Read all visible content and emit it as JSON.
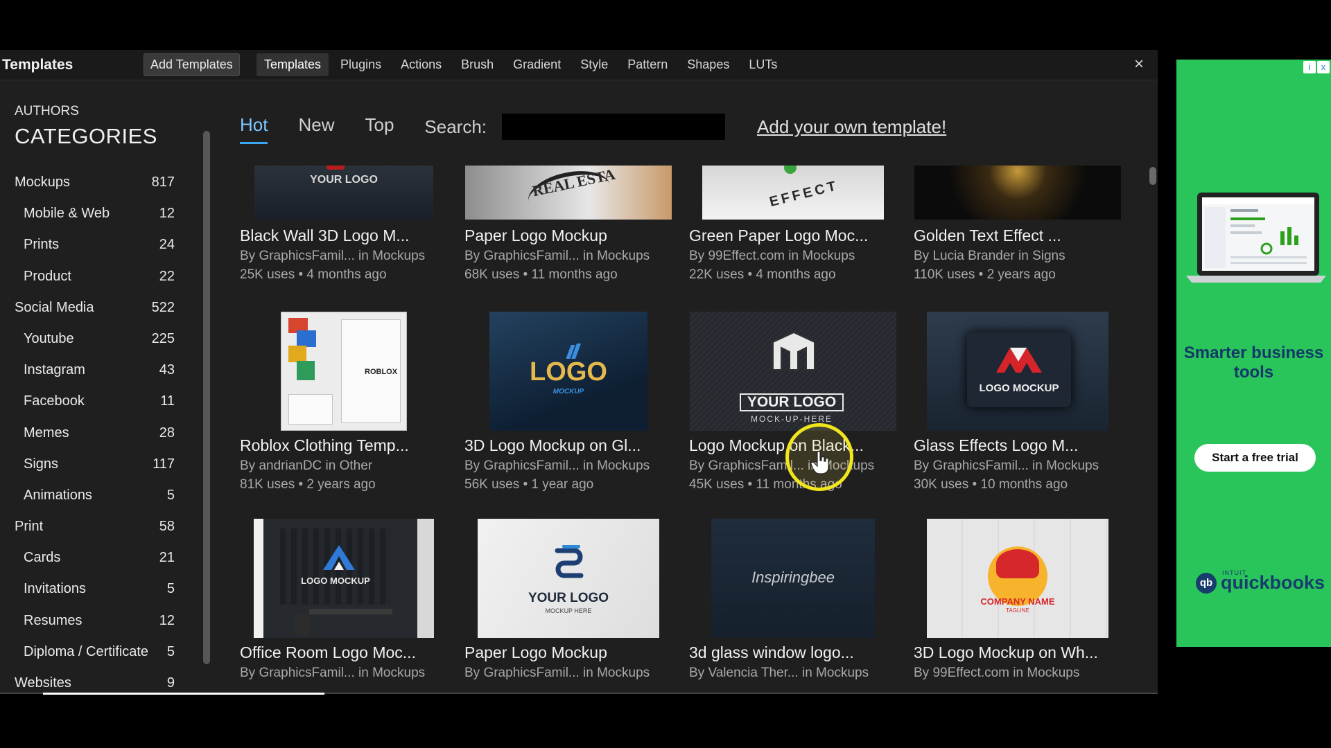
{
  "window": {
    "title": "Templates",
    "add_templates_label": "Add Templates",
    "tabs": [
      "Templates",
      "Plugins",
      "Actions",
      "Brush",
      "Gradient",
      "Style",
      "Pattern",
      "Shapes",
      "LUTs"
    ],
    "active_tab": "Templates",
    "close_label": "×"
  },
  "sidebar": {
    "authors_label": "AUTHORS",
    "categories_title": "CATEGORIES",
    "items": [
      {
        "label": "Mockups",
        "count": "817",
        "level": "top"
      },
      {
        "label": "Mobile & Web",
        "count": "12",
        "level": "sub"
      },
      {
        "label": "Prints",
        "count": "24",
        "level": "sub"
      },
      {
        "label": "Product",
        "count": "22",
        "level": "sub"
      },
      {
        "label": "Social Media",
        "count": "522",
        "level": "top"
      },
      {
        "label": "Youtube",
        "count": "225",
        "level": "sub"
      },
      {
        "label": "Instagram",
        "count": "43",
        "level": "sub"
      },
      {
        "label": "Facebook",
        "count": "11",
        "level": "sub"
      },
      {
        "label": "Memes",
        "count": "28",
        "level": "sub"
      },
      {
        "label": "Signs",
        "count": "117",
        "level": "sub"
      },
      {
        "label": "Animations",
        "count": "5",
        "level": "sub"
      },
      {
        "label": "Print",
        "count": "58",
        "level": "top"
      },
      {
        "label": "Cards",
        "count": "21",
        "level": "sub"
      },
      {
        "label": "Invitations",
        "count": "5",
        "level": "sub"
      },
      {
        "label": "Resumes",
        "count": "12",
        "level": "sub"
      },
      {
        "label": "Diploma / Certificate",
        "count": "5",
        "level": "sub"
      },
      {
        "label": "Websites",
        "count": "9",
        "level": "top"
      }
    ]
  },
  "content": {
    "subtabs": [
      "Hot",
      "New",
      "Top"
    ],
    "active_subtab": "Hot",
    "search_label": "Search:",
    "search_value": "",
    "add_own_label": "Add your own template!",
    "cards": [
      {
        "title": "Black Wall 3D Logo M...",
        "byline": "By GraphicsFamil... in Mockups",
        "stats": "25K uses • 4 months ago",
        "thumb_text": "YOUR LOGO",
        "thumb_style": "blackwall"
      },
      {
        "title": "Paper Logo Mockup",
        "byline": "By GraphicsFamil... in Mockups",
        "stats": "68K uses • 11 months ago",
        "thumb_text": "REAL ESTA",
        "thumb_style": "paper1"
      },
      {
        "title": "Green Paper Logo Moc...",
        "byline": "By 99Effect.com in Mockups",
        "stats": "22K uses • 4 months ago",
        "thumb_text": "EFFECT",
        "thumb_style": "greenpaper"
      },
      {
        "title": "Golden Text Effect ...",
        "byline": "By Lucia Brander in Signs",
        "stats": "110K uses • 2 years ago",
        "thumb_text": "",
        "thumb_style": "golden"
      },
      {
        "title": "Roblox Clothing Temp...",
        "byline": "By andrianDC in Other",
        "stats": "81K uses • 2 years ago",
        "thumb_text": "ROBLOX",
        "thumb_style": "roblox"
      },
      {
        "title": "3D Logo Mockup on Gl...",
        "byline": "By GraphicsFamil... in Mockups",
        "stats": "56K uses • 1 year ago",
        "thumb_text": "LOGO",
        "thumb_style": "glass"
      },
      {
        "title": "Logo Mockup on Black...",
        "byline": "By GraphicsFamil... in Mockups",
        "stats": "45K uses • 11 months ago",
        "thumb_text": "YOUR LOGO",
        "thumb_style": "black"
      },
      {
        "title": "Glass Effects Logo M...",
        "byline": "By GraphicsFamil... in Mockups",
        "stats": "30K uses • 10 months ago",
        "thumb_text": "LOGO MOCKUP",
        "thumb_style": "glasseffect"
      },
      {
        "title": "Office Room Logo Moc...",
        "byline": "By GraphicsFamil... in Mockups",
        "stats": "",
        "thumb_text": "LOGO MOCKUP",
        "thumb_style": "office"
      },
      {
        "title": "Paper Logo Mockup",
        "byline": "By GraphicsFamil... in Mockups",
        "stats": "",
        "thumb_text": "YOUR LOGO",
        "thumb_style": "paper2"
      },
      {
        "title": "3d glass window logo...",
        "byline": "By Valencia Ther... in Mockups",
        "stats": "",
        "thumb_text": "Inspiringbee",
        "thumb_style": "window"
      },
      {
        "title": "3D Logo Mockup on Wh...",
        "byline": "By 99Effect.com in Mockups",
        "stats": "",
        "thumb_text": "COMPANY NAME",
        "thumb_style": "white"
      }
    ]
  },
  "ad": {
    "headline": "Smarter business tools",
    "cta_label": "Start a free trial",
    "brand_name": "quickbooks",
    "brand_small": "INTUIT",
    "brand_logo_glyph": "qb",
    "info_glyph": "i",
    "close_glyph": "x",
    "background_color": "#2ac55a",
    "headline_color": "#12386a"
  },
  "colors": {
    "accent_tab": "#39a7f2",
    "window_bg": "#1f1f1f",
    "cursor_ring": "#f1e51c"
  }
}
